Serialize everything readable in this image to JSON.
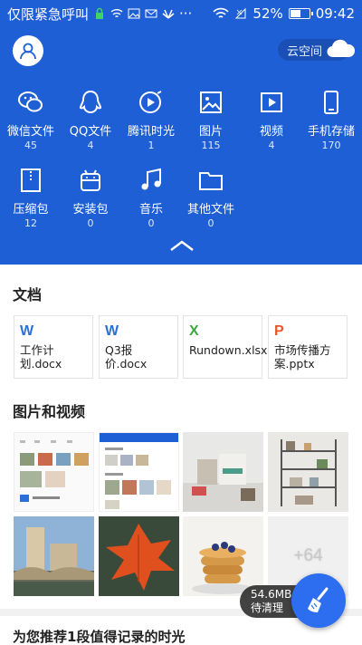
{
  "status_bar": {
    "carrier": "仅限紧急呼叫",
    "battery_percent": "52%",
    "battery_level": 0.52,
    "time": "09:42",
    "icons": [
      "lock-icon",
      "wifi-icon",
      "image-icon",
      "mail-icon",
      "huawei-icon",
      "more-icon",
      "wifi-icon",
      "signal-icon",
      "battery-icon"
    ]
  },
  "header": {
    "cloud_label": "云空间",
    "categories": [
      {
        "label": "微信文件",
        "count": "45",
        "icon": "wechat-icon"
      },
      {
        "label": "QQ文件",
        "count": "4",
        "icon": "qq-icon"
      },
      {
        "label": "腾讯时光",
        "count": "1",
        "icon": "play-circle-icon"
      },
      {
        "label": "图片",
        "count": "115",
        "icon": "image-icon"
      },
      {
        "label": "视频",
        "count": "4",
        "icon": "video-icon"
      },
      {
        "label": "手机存储",
        "count": "170",
        "icon": "phone-icon"
      },
      {
        "label": "压缩包",
        "count": "12",
        "icon": "zip-icon"
      },
      {
        "label": "安装包",
        "count": "0",
        "icon": "android-icon"
      },
      {
        "label": "音乐",
        "count": "0",
        "icon": "music-icon"
      },
      {
        "label": "其他文件",
        "count": "0",
        "icon": "folder-icon"
      }
    ]
  },
  "documents": {
    "title": "文档",
    "items": [
      {
        "badge": "W",
        "name": "工作计划.docx",
        "color": "#2b6fd8"
      },
      {
        "badge": "W",
        "name": "Q3报价.docx",
        "color": "#2b6fd8"
      },
      {
        "badge": "X",
        "name": "Rundown.xlsx",
        "color": "#3aaa3a"
      },
      {
        "badge": "P",
        "name": "市场传播方案.pptx",
        "color": "#e8562a"
      }
    ]
  },
  "media": {
    "title": "图片和视频",
    "more_count": "+64"
  },
  "recommend": {
    "title": "为您推荐1段值得记录的时光"
  },
  "cleaner": {
    "size": "54.6MB",
    "label": "待清理"
  },
  "colors": {
    "brand_blue": "#1f5fd6",
    "fab_blue": "#2d6ef0"
  }
}
